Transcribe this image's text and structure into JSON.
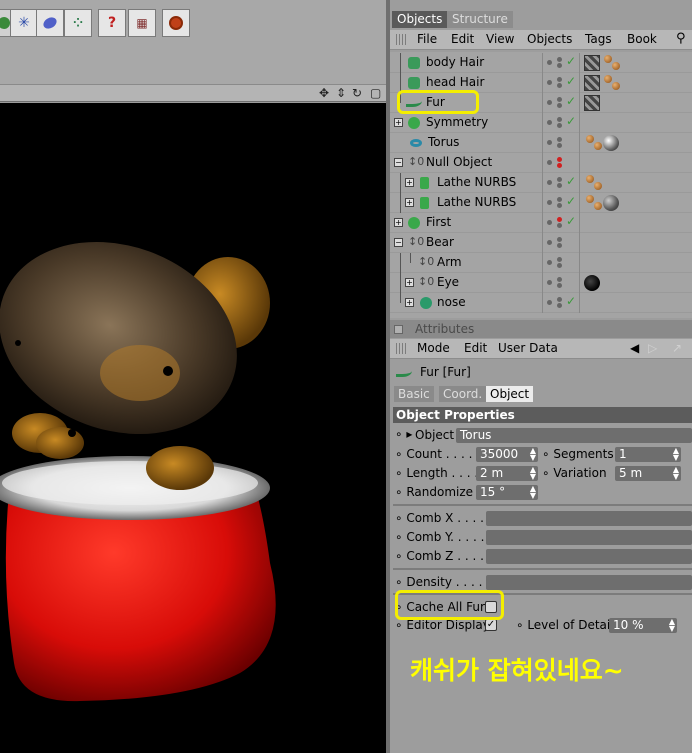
{
  "manager": {
    "tabs": [
      "Objects",
      "Structure"
    ],
    "menu": [
      "File",
      "Edit",
      "View",
      "Objects",
      "Tags",
      "Book"
    ]
  },
  "objects": [
    {
      "name": "body Hair",
      "icon": "hair-icon"
    },
    {
      "name": "head Hair",
      "icon": "hair-icon"
    },
    {
      "name": "Fur",
      "icon": "fur-icon"
    },
    {
      "name": "Symmetry",
      "icon": "symmetry-icon"
    },
    {
      "name": "Torus",
      "icon": "torus-icon"
    },
    {
      "name": "Null Object",
      "icon": "null-object-icon"
    },
    {
      "name": "Lathe NURBS",
      "icon": "lathe-nurbs-icon"
    },
    {
      "name": "Lathe NURBS",
      "icon": "lathe-nurbs-icon"
    },
    {
      "name": "First",
      "icon": "symmetry-icon"
    },
    {
      "name": "Bear",
      "icon": "null-object-icon"
    },
    {
      "name": "Arm",
      "icon": "null-object-icon"
    },
    {
      "name": "Eye",
      "icon": "null-object-icon"
    },
    {
      "name": "nose",
      "icon": "sphere-icon"
    }
  ],
  "attributes": {
    "tab_label": "Attributes",
    "menu": [
      "Mode",
      "Edit",
      "User Data"
    ],
    "object_title": "Fur [Fur]",
    "subtabs": [
      "Basic",
      "Coord.",
      "Object"
    ],
    "section": "Object Properties",
    "object_label": "Object",
    "object_value": "Torus",
    "count_label": "Count . . . . .",
    "count_value": "35000",
    "segments_label": "Segments",
    "segments_value": "1",
    "length_label": "Length . . . .",
    "length_value": "2 m",
    "variation_label": "Variation",
    "variation_value": "5 m",
    "randomize_label": "Randomize",
    "randomize_value": "15 °",
    "combx_label": "Comb X . . . . . .",
    "comby_label": "Comb Y. . . . . .",
    "combz_label": "Comb Z . . . . . .",
    "density_label": "Density . . . . . .",
    "cache_label": "Cache All Fur",
    "cache_checked": false,
    "editor_display_label": "Editor Display",
    "editor_display_checked": true,
    "lod_label": "Level of Detail",
    "lod_value": "10 %"
  },
  "annotation": {
    "note": "캐쉬가 잡혀있네요~",
    "highlight_color": "#f4ee00"
  }
}
